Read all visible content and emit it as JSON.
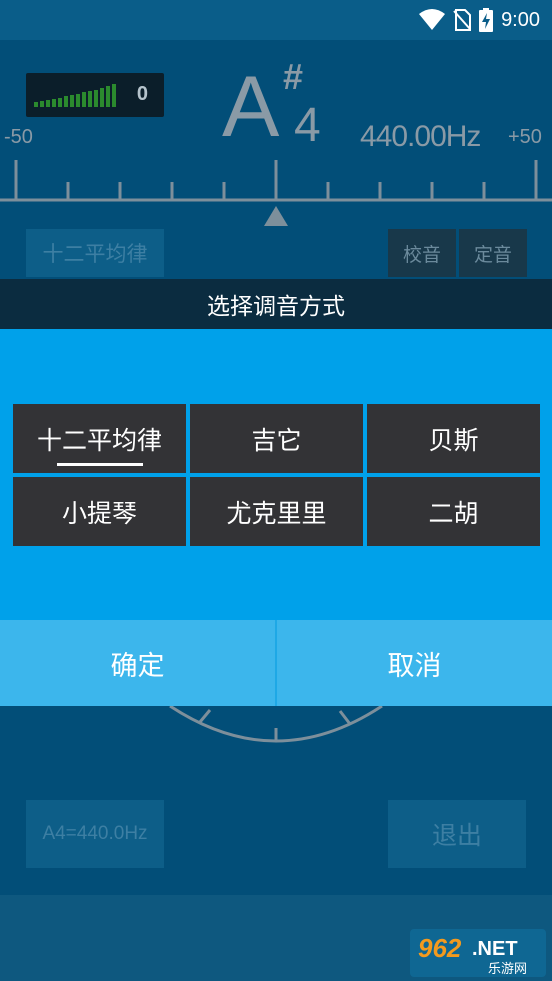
{
  "status_bar": {
    "time": "9:00"
  },
  "tuner": {
    "meter_count": "0",
    "note": "A",
    "accidental": "#",
    "octave": "4",
    "frequency": "440.00Hz",
    "scale_min": "-50",
    "scale_max": "+50"
  },
  "background_buttons": {
    "temperament": "十二平均律",
    "calibrate": "校音",
    "fixed_pitch": "定音",
    "reference": "A4=440.0Hz",
    "exit": "退出"
  },
  "dialog": {
    "title": "选择调音方式",
    "selected": "十二平均律",
    "options": [
      "十二平均律",
      "吉它",
      "贝斯",
      "小提琴",
      "尤克里里",
      "二胡"
    ],
    "confirm_label": "确定",
    "cancel_label": "取消"
  },
  "watermark": {
    "brand": "962.NET",
    "subtitle": "乐游网"
  },
  "colors": {
    "background": "#024e78",
    "dialog_body": "#00a1ea",
    "dialog_footer": "#3cb6ec",
    "option_bg": "#333336",
    "dialog_title_bg": "#0b2c40"
  }
}
